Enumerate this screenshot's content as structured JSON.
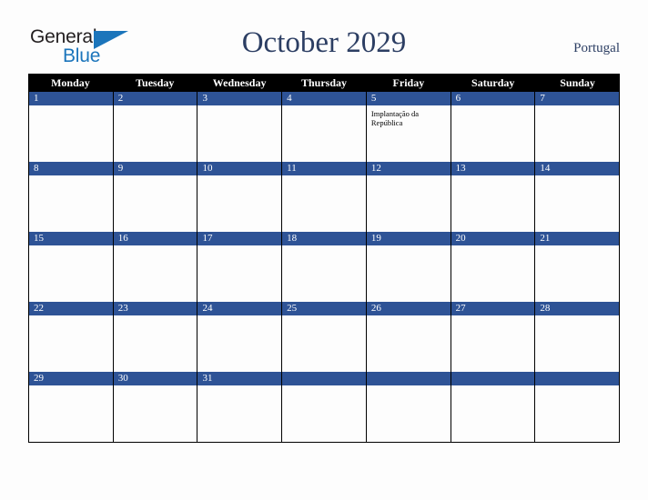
{
  "brand": {
    "name_part1": "General",
    "name_part2": "Blue",
    "triangle_icon": "triangle-icon",
    "accent_dark": "#231f20",
    "accent_blue": "#1b75bb"
  },
  "header": {
    "title": "October 2029",
    "country": "Portugal",
    "title_color": "#2c3e63"
  },
  "calendar": {
    "month": "October",
    "year": "2029",
    "header_bg": "#000000",
    "date_bar_bg": "#2e5396",
    "weekday_headers": [
      "Monday",
      "Tuesday",
      "Wednesday",
      "Thursday",
      "Friday",
      "Saturday",
      "Sunday"
    ],
    "weeks": [
      [
        {
          "day": "1",
          "events": []
        },
        {
          "day": "2",
          "events": []
        },
        {
          "day": "3",
          "events": []
        },
        {
          "day": "4",
          "events": []
        },
        {
          "day": "5",
          "events": [
            "Implantação da República"
          ]
        },
        {
          "day": "6",
          "events": []
        },
        {
          "day": "7",
          "events": []
        }
      ],
      [
        {
          "day": "8",
          "events": []
        },
        {
          "day": "9",
          "events": []
        },
        {
          "day": "10",
          "events": []
        },
        {
          "day": "11",
          "events": []
        },
        {
          "day": "12",
          "events": []
        },
        {
          "day": "13",
          "events": []
        },
        {
          "day": "14",
          "events": []
        }
      ],
      [
        {
          "day": "15",
          "events": []
        },
        {
          "day": "16",
          "events": []
        },
        {
          "day": "17",
          "events": []
        },
        {
          "day": "18",
          "events": []
        },
        {
          "day": "19",
          "events": []
        },
        {
          "day": "20",
          "events": []
        },
        {
          "day": "21",
          "events": []
        }
      ],
      [
        {
          "day": "22",
          "events": []
        },
        {
          "day": "23",
          "events": []
        },
        {
          "day": "24",
          "events": []
        },
        {
          "day": "25",
          "events": []
        },
        {
          "day": "26",
          "events": []
        },
        {
          "day": "27",
          "events": []
        },
        {
          "day": "28",
          "events": []
        }
      ],
      [
        {
          "day": "29",
          "events": []
        },
        {
          "day": "30",
          "events": []
        },
        {
          "day": "31",
          "events": []
        },
        {
          "day": "",
          "events": []
        },
        {
          "day": "",
          "events": []
        },
        {
          "day": "",
          "events": []
        },
        {
          "day": "",
          "events": []
        }
      ]
    ]
  }
}
